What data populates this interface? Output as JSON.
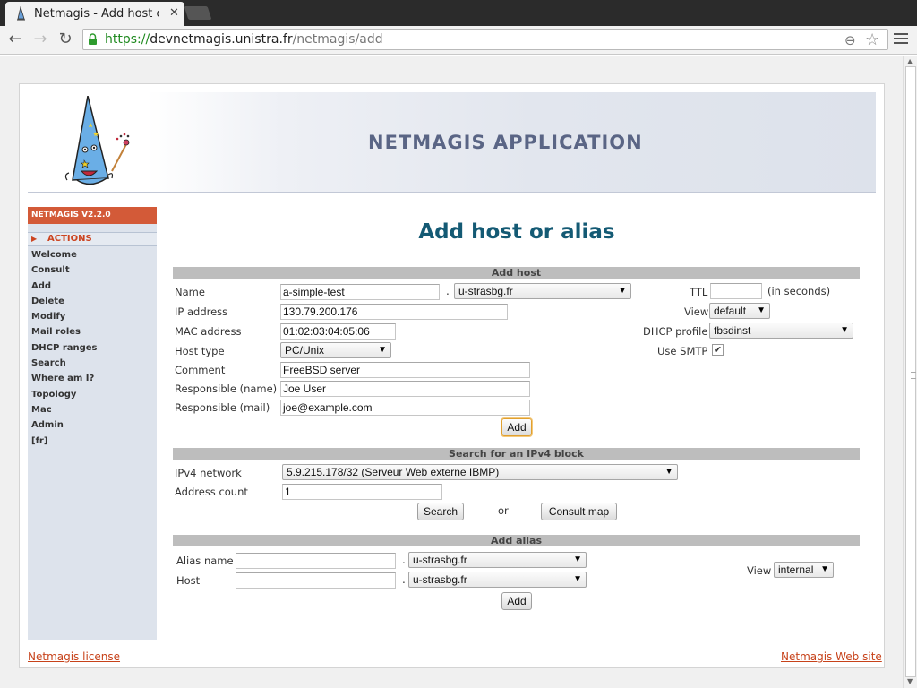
{
  "browser": {
    "tab_title": "Netmagis - Add host or ali",
    "url_scheme": "https://",
    "url_host": "devnetmagis.unistra.fr",
    "url_path": "/netmagis/add"
  },
  "header": {
    "app_title": "NETMAGIS APPLICATION"
  },
  "sidebar": {
    "version": "NETMAGIS V2.2.0",
    "actions_label": "ACTIONS",
    "items": [
      {
        "label": "Welcome"
      },
      {
        "label": "Consult"
      },
      {
        "label": "Add"
      },
      {
        "label": "Delete"
      },
      {
        "label": "Modify"
      },
      {
        "label": "Mail roles"
      },
      {
        "label": "DHCP ranges"
      },
      {
        "label": "Search"
      },
      {
        "label": "Where am I?"
      },
      {
        "label": "Topology"
      },
      {
        "label": "Mac"
      },
      {
        "label": "Admin"
      },
      {
        "label": "[fr]"
      }
    ]
  },
  "main": {
    "title": "Add host or alias"
  },
  "add_host": {
    "section_title": "Add host",
    "name_label": "Name",
    "name_value": "a-simple-test",
    "domain_value": "u-strasbg.fr",
    "ttl_label": "TTL",
    "ttl_value": "",
    "ttl_unit": "(in seconds)",
    "ip_label": "IP address",
    "ip_value": "130.79.200.176",
    "view_label": "View",
    "view_value": "default",
    "mac_label": "MAC address",
    "mac_value": "01:02:03:04:05:06",
    "dhcp_label": "DHCP profile",
    "dhcp_value": "fbsdinst",
    "hosttype_label": "Host type",
    "hosttype_value": "PC/Unix",
    "smtp_label": "Use SMTP",
    "smtp_checked": true,
    "comment_label": "Comment",
    "comment_value": "FreeBSD server",
    "resp_name_label": "Responsible (name)",
    "resp_name_value": "Joe User",
    "resp_mail_label": "Responsible (mail)",
    "resp_mail_value": "joe@example.com",
    "add_button": "Add"
  },
  "search_block": {
    "section_title": "Search for an IPv4 block",
    "network_label": "IPv4 network",
    "network_value": "5.9.215.178/32 (Serveur Web externe IBMP)",
    "count_label": "Address count",
    "count_value": "1",
    "search_button": "Search",
    "or_text": "or",
    "consult_button": "Consult map"
  },
  "add_alias": {
    "section_title": "Add alias",
    "alias_label": "Alias name",
    "alias_value": "",
    "alias_domain": "u-strasbg.fr",
    "host_label": "Host",
    "host_value": "",
    "host_domain": "u-strasbg.fr",
    "view_label": "View",
    "view_value": "internal",
    "add_button": "Add"
  },
  "footer": {
    "license_link": "Netmagis license",
    "website_link": "Netmagis Web site"
  },
  "colors": {
    "accent": "#d35a38",
    "title": "#145a74",
    "sidebar_bg": "#dde3ec"
  }
}
